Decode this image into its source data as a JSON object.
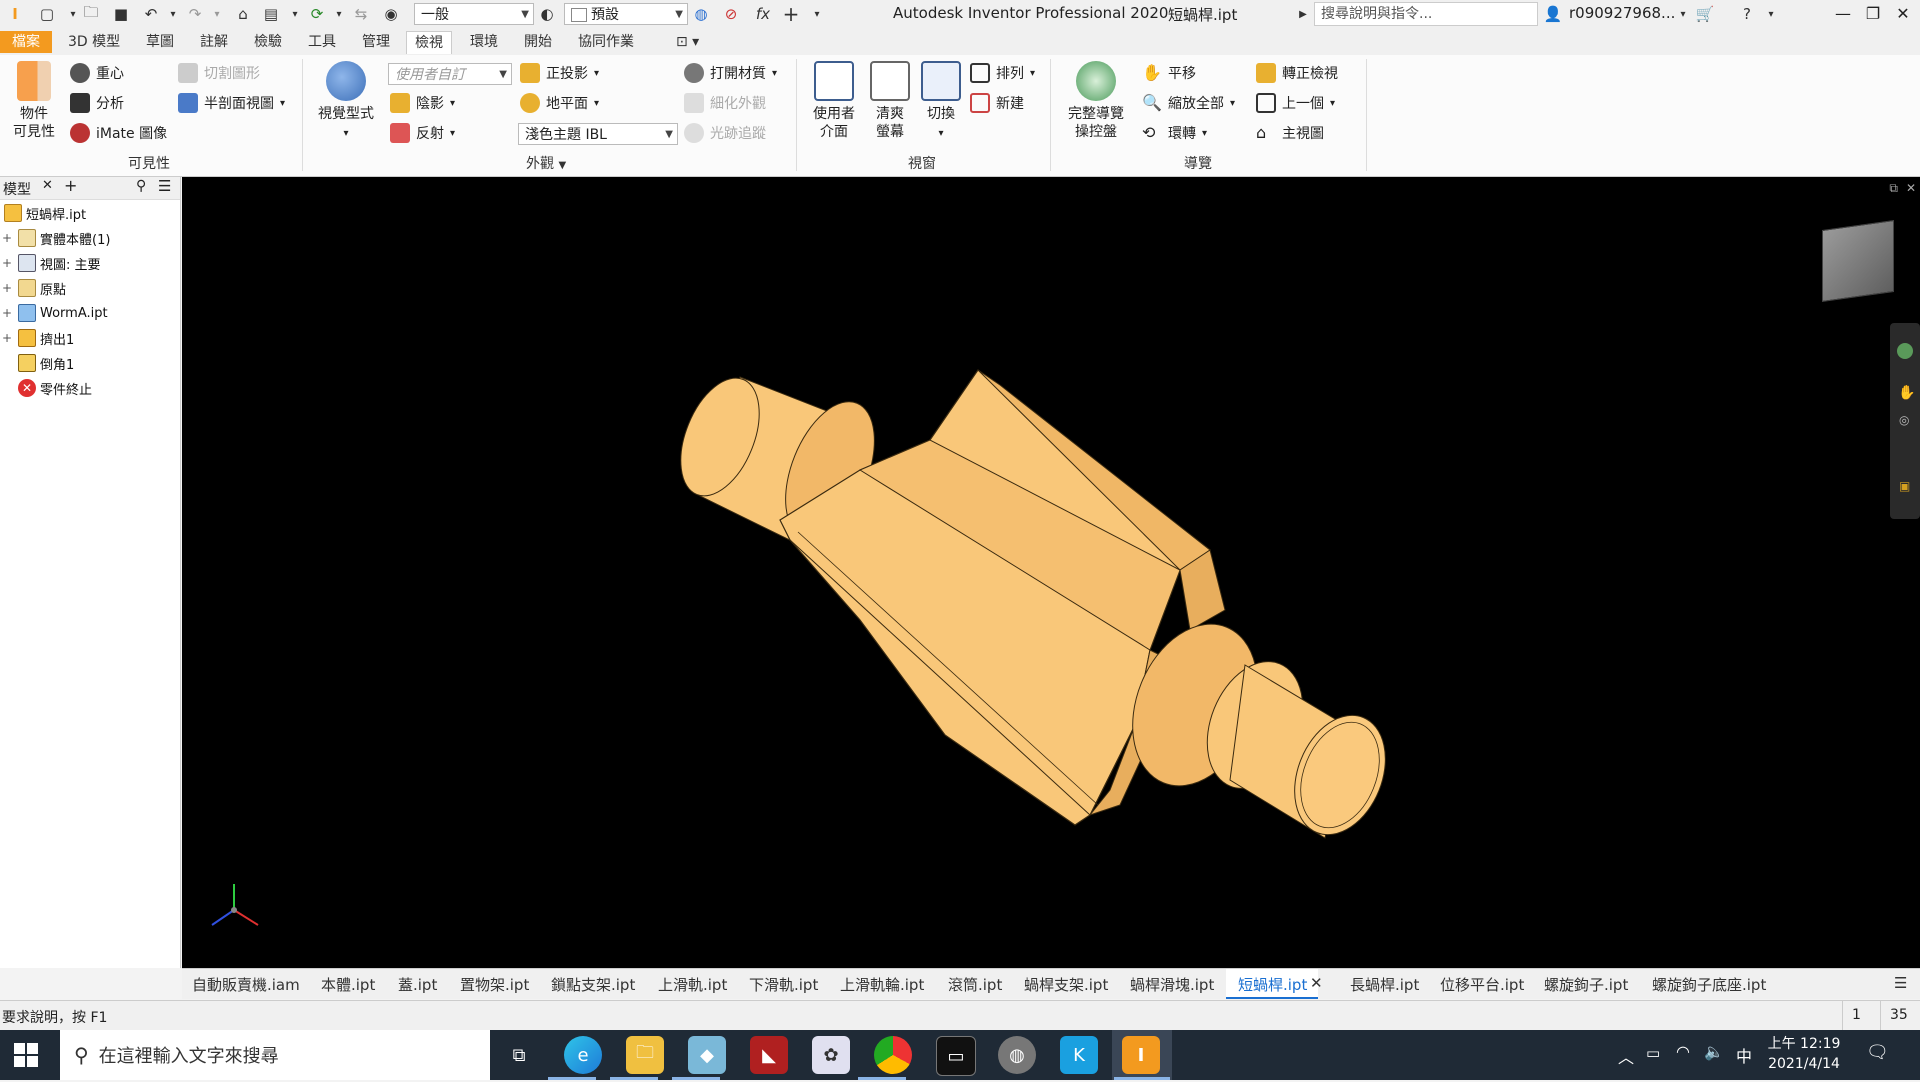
{
  "titlebar": {
    "app_title": "Autodesk Inventor Professional 2020",
    "file_title": "短蝸桿.ipt",
    "style_combo": "一般",
    "appearance_combo": "預設",
    "search_placeholder": "搜尋說明與指令...",
    "user_name": "r090927968...",
    "fx_label": "fx"
  },
  "tabs": [
    {
      "label": "檔案"
    },
    {
      "label": "3D 模型"
    },
    {
      "label": "草圖"
    },
    {
      "label": "註解"
    },
    {
      "label": "檢驗"
    },
    {
      "label": "工具"
    },
    {
      "label": "管理"
    },
    {
      "label": "檢視"
    },
    {
      "label": "環境"
    },
    {
      "label": "開始"
    },
    {
      "label": "協同作業"
    }
  ],
  "ribbon": {
    "visibility": {
      "object_visibility": "物件\n可見性",
      "center_of_gravity": "重心",
      "analysis": "分析",
      "imate": "iMate 圖像",
      "cut_shape": "切割圖形",
      "half_section": "半剖面視圖",
      "group_label": "可見性"
    },
    "appearance": {
      "visual_style": "視覺型式",
      "user_defined": "使用者自訂",
      "shadow": "陰影",
      "reflection": "反射",
      "orthographic": "正投影",
      "ground_plane": "地平面",
      "ibl_theme": "淺色主題 IBL",
      "open_material": "打開材質",
      "refine_appearance": "細化外觀",
      "ray_tracing": "光跡追蹤",
      "group_label": "外觀"
    },
    "window": {
      "user_interface": "使用者\n介面",
      "clean_screen": "清爽\n螢幕",
      "switch": "切換",
      "arrange": "排列",
      "new": "新建",
      "group_label": "視窗"
    },
    "navigate": {
      "full_nav_wheel": "完整導覽\n操控盤",
      "pan": "平移",
      "zoom_all": "縮放全部",
      "orbit": "環轉",
      "look_at": "轉正檢視",
      "previous": "上一個",
      "home_view": "主視圖",
      "group_label": "導覽"
    }
  },
  "browser": {
    "title": "模型",
    "tree": [
      {
        "label": "短蝸桿.ipt",
        "icon": "part-icon",
        "expandable": false
      },
      {
        "label": "實體本體(1)",
        "icon": "solid-body-folder-icon",
        "expandable": true
      },
      {
        "label": "視圖: 主要",
        "icon": "view-rep-icon",
        "expandable": true
      },
      {
        "label": "原點",
        "icon": "origin-folder-icon",
        "expandable": true
      },
      {
        "label": "WormA.ipt",
        "icon": "derived-part-icon",
        "expandable": true
      },
      {
        "label": "擠出1",
        "icon": "extrude-icon",
        "expandable": true
      },
      {
        "label": "倒角1",
        "icon": "chamfer-icon",
        "expandable": false
      },
      {
        "label": "零件終止",
        "icon": "end-of-part-icon",
        "expandable": false
      }
    ]
  },
  "doc_tabs": [
    {
      "label": "自動販賣機.iam",
      "active": false
    },
    {
      "label": "本體.ipt",
      "active": false
    },
    {
      "label": "蓋.ipt",
      "active": false
    },
    {
      "label": "置物架.ipt",
      "active": false
    },
    {
      "label": "鎖點支架.ipt",
      "active": false
    },
    {
      "label": "上滑軌.ipt",
      "active": false
    },
    {
      "label": "下滑軌.ipt",
      "active": false
    },
    {
      "label": "上滑軌輪.ipt",
      "active": false
    },
    {
      "label": "滾筒.ipt",
      "active": false
    },
    {
      "label": "蝸桿支架.ipt",
      "active": false
    },
    {
      "label": "蝸桿滑塊.ipt",
      "active": false
    },
    {
      "label": "短蝸桿.ipt",
      "active": true
    },
    {
      "label": "長蝸桿.ipt",
      "active": false
    },
    {
      "label": "位移平台.ipt",
      "active": false
    },
    {
      "label": "螺旋鉤子.ipt",
      "active": false
    },
    {
      "label": "螺旋鉤子底座.ipt",
      "active": false
    }
  ],
  "statusbar": {
    "help_text": "要求說明，按 F1",
    "count_1": "1",
    "count_2": "35"
  },
  "taskbar": {
    "search_placeholder": "在這裡輸入文字來搜尋",
    "time": "上午 12:19",
    "date": "2021/4/14",
    "ime": "中"
  },
  "colors": {
    "file_tab": "#f39a1f",
    "model_fill": "#f9c779",
    "model_shade": "#e8ae5d",
    "active_doc_tab": "#1a6fd1",
    "viewport_bg": "#000000",
    "taskbar_bg": "#1f2a36"
  }
}
